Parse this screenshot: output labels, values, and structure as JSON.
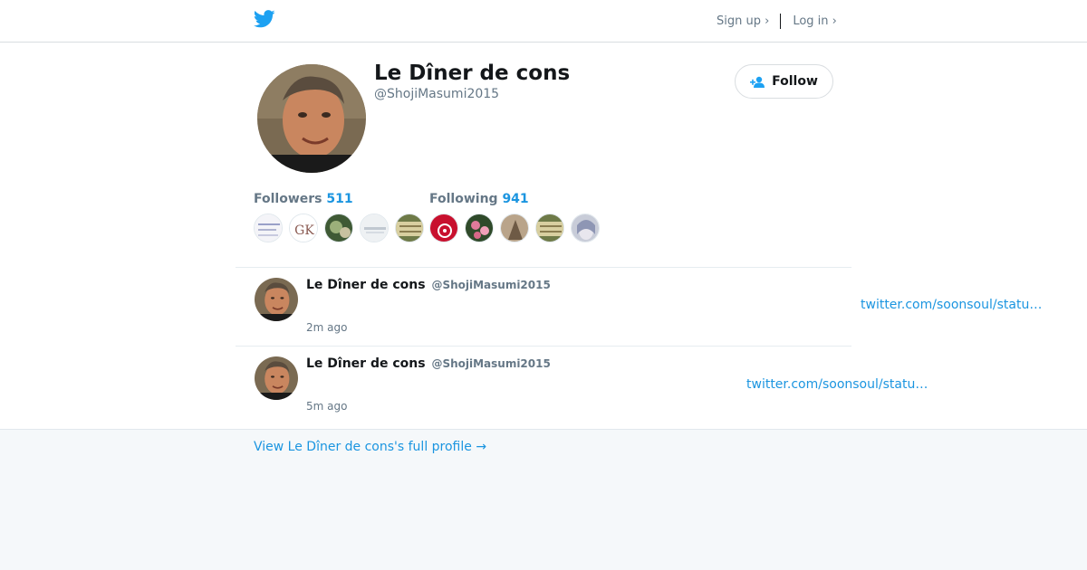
{
  "header": {
    "signup_label": "Sign up ›",
    "login_label": "Log in ›",
    "logo_icon": "twitter-bird-icon",
    "brand_color": "#1da1f2"
  },
  "profile": {
    "name": "Le Dîner de cons",
    "handle": "@ShojiMasumi2015",
    "follow_label": "Follow",
    "followers_label": "Followers",
    "followers_count": "511",
    "following_label": "Following",
    "following_count": "941"
  },
  "tweets": [
    {
      "name": "Le Dîner de cons",
      "handle": "@ShojiMasumi2015",
      "time": "2m ago",
      "link": "twitter.com/soonsoul/statu…"
    },
    {
      "name": "Le Dîner de cons",
      "handle": "@ShojiMasumi2015",
      "time": "5m ago",
      "link": "twitter.com/soonsoul/statu…"
    }
  ],
  "footer": {
    "profile_link": "View Le Dîner de cons's full profile →"
  }
}
